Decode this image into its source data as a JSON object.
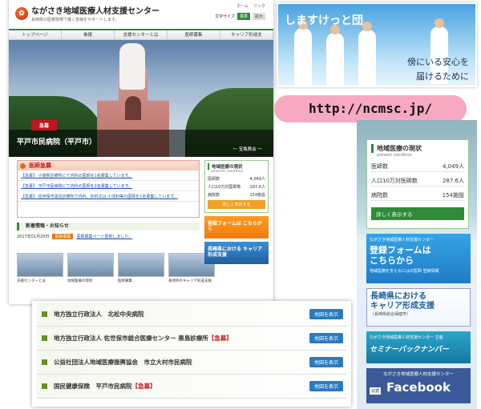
{
  "header": {
    "logo_title": "ながさき地域医療人材支援センター",
    "logo_sub": "長崎県の医療現場で働く皆様をサポートします。",
    "link_home": "ホーム",
    "link_links": "リンク",
    "fontsize_label": "文字サイズ",
    "fontsize_std": "標準",
    "fontsize_large": "拡大"
  },
  "nav": [
    "トップページ",
    "後援",
    "支援センターとは",
    "医師募集",
    "キャリア形成支"
  ],
  "hero": {
    "tag": "急募",
    "title": "平戸市民病院（平戸市）",
    "caption": "～ 宝亀教会 ～"
  },
  "urgent": {
    "heading": "医師急募",
    "items": [
      "【急募】 小値賀診療所にて内科の医師を1名募集しています。",
      "【急募】 平戸市民病院にて内科の医師を2名募集しています。",
      "【急募】 佐世保市黒島診療所で内科、外科又は 小児科等の医師を1名募集しています。"
    ]
  },
  "news": {
    "heading": "新着情報・お知らせ",
    "date": "2017年01月20日",
    "badge": "医師募集",
    "link": "医師募集ページ更新しました。"
  },
  "thumbs": [
    "支援センターとは",
    "地域医療の現状",
    "医師募集",
    "長崎県のキャリア形成支援"
  ],
  "side_stats": {
    "heading": "地域医療の現状",
    "sub": "present condition",
    "rows": [
      {
        "label": "医師数",
        "value": "4,049人"
      },
      {
        "label": "人口10万対医師数",
        "value": "287.6人"
      },
      {
        "label": "病院数",
        "value": "154施設"
      }
    ],
    "button": "詳しく表示する"
  },
  "side_banners": [
    "登録フォームは こちらから",
    "長崎県における キャリア形成支援"
  ],
  "hospital_list": [
    {
      "name": "地方独立行政法人　北松中央病院",
      "urgent": "",
      "button": "地図を表示"
    },
    {
      "name": "地方独立行政法人 佐世保市総合医療センター 黒島診療所",
      "urgent": "【急募】",
      "button": "地図を表示"
    },
    {
      "name": "公益社団法人地域医療振興協会　市立大村市民病院",
      "urgent": "",
      "button": "地図を表示"
    },
    {
      "name": "国民健康保険　平戸市民病院",
      "urgent": "【急募】",
      "button": "地図を表示"
    }
  ],
  "photo": {
    "title": "しますけっと団",
    "caption1": "傍にいる安心を",
    "caption2": "届けるために"
  },
  "url": "http://ncmsc.jp/",
  "right_stats": {
    "heading": "地域医療の現状",
    "sub": "present condition",
    "rows": [
      {
        "label": "医師数",
        "value": "4,049人"
      },
      {
        "label": "人口10万対医師数",
        "value": "287.6人"
      },
      {
        "label": "病院数",
        "value": "154施設"
      }
    ],
    "button": "詳しく表示する"
  },
  "register": {
    "top": "ながさき地域医療人材支援センター",
    "main1": "登録フォームは",
    "main2": "こちらから",
    "sub": "地域医療を支えるにはの医師 登録情報"
  },
  "career": {
    "main1": "長崎県における",
    "main2": "キャリア形成支援",
    "sub": "（長崎県総合保健学）"
  },
  "seminar": {
    "top": "ながさき地域医療人材支援センター 主催",
    "main": "セミナーバックナンバー"
  },
  "facebook": {
    "top": "ながさき地域医療人材支援センター",
    "badge": "公式",
    "main": "Facebook"
  }
}
